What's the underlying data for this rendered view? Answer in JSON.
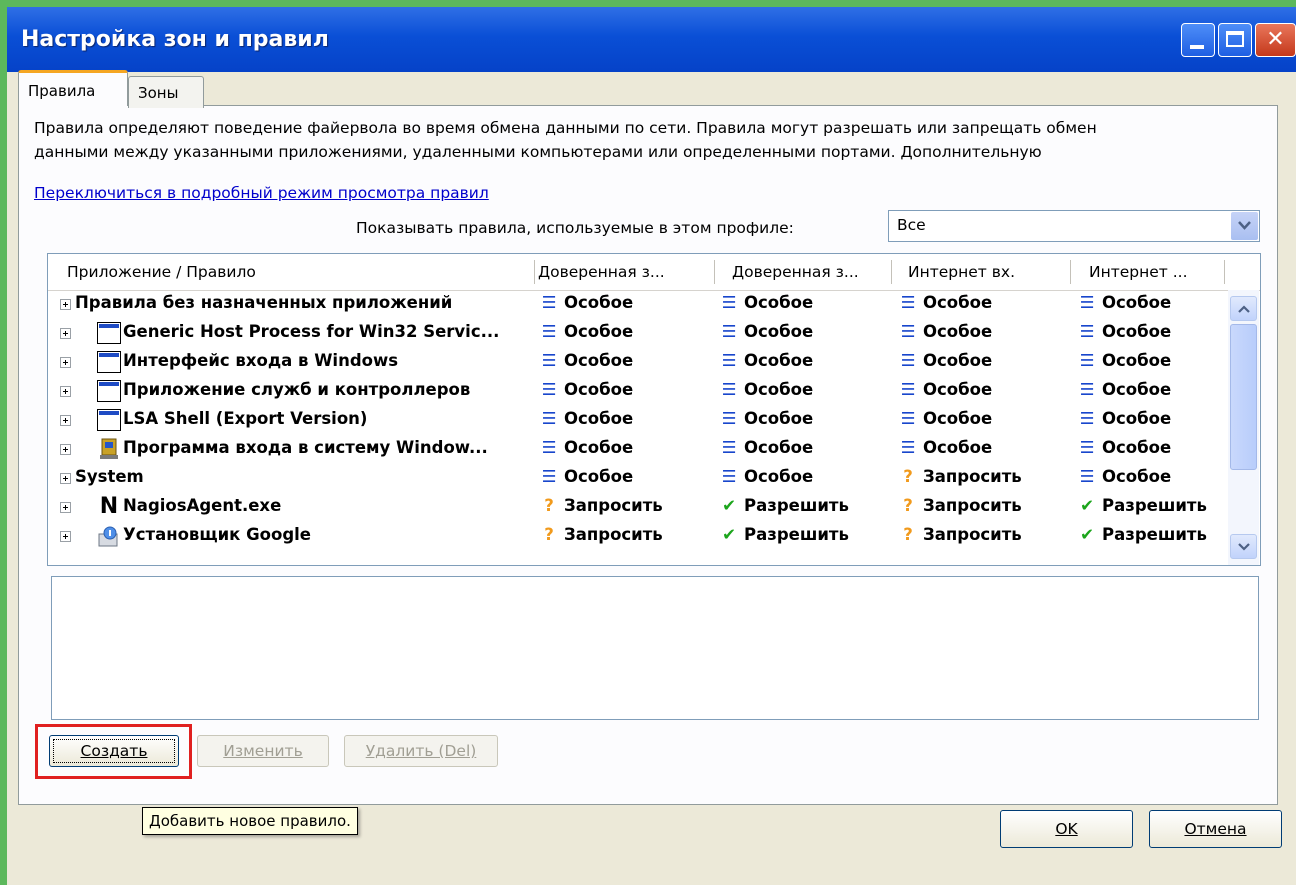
{
  "window": {
    "title": "Настройка зон и правил"
  },
  "tabs": [
    {
      "label": "Правила",
      "active": true
    },
    {
      "label": "Зоны",
      "active": false
    }
  ],
  "description": {
    "line1": "Правила определяют поведение файервола во время обмена данными по сети. Правила могут разрешать или запрещать обмен",
    "line2": "данными между указанными приложениями, удаленными компьютерами или определенными портами. Дополнительную"
  },
  "detail_link": "Переключиться в подробный режим просмотра правил",
  "profile": {
    "label": "Показывать правила, используемые в этом профиле:",
    "value": "Все"
  },
  "table": {
    "columns": [
      "Приложение / Правило",
      "Доверенная з...",
      "Доверенная з...",
      "Интернет вх.",
      "Интернет ..."
    ],
    "rows": [
      {
        "name": "Правила без назначенных приложений",
        "icon": "none",
        "cells": [
          {
            "icon": "lines-icon",
            "text": "Особое"
          },
          {
            "icon": "lines-icon",
            "text": "Особое"
          },
          {
            "icon": "lines-icon",
            "text": "Особое"
          },
          {
            "icon": "lines-icon",
            "text": "Особое"
          }
        ]
      },
      {
        "name": "Generic Host Process for Win32 Servic...",
        "icon": "window-icon",
        "cells": [
          {
            "icon": "lines-icon",
            "text": "Особое"
          },
          {
            "icon": "lines-icon",
            "text": "Особое"
          },
          {
            "icon": "lines-icon",
            "text": "Особое"
          },
          {
            "icon": "lines-icon",
            "text": "Особое"
          }
        ]
      },
      {
        "name": "Интерфейс входа в Windows",
        "icon": "window-icon",
        "cells": [
          {
            "icon": "lines-icon",
            "text": "Особое"
          },
          {
            "icon": "lines-icon",
            "text": "Особое"
          },
          {
            "icon": "lines-icon",
            "text": "Особое"
          },
          {
            "icon": "lines-icon",
            "text": "Особое"
          }
        ]
      },
      {
        "name": "Приложение служб и контроллеров",
        "icon": "window-icon",
        "cells": [
          {
            "icon": "lines-icon",
            "text": "Особое"
          },
          {
            "icon": "lines-icon",
            "text": "Особое"
          },
          {
            "icon": "lines-icon",
            "text": "Особое"
          },
          {
            "icon": "lines-icon",
            "text": "Особое"
          }
        ]
      },
      {
        "name": "LSA Shell (Export Version)",
        "icon": "window-icon",
        "cells": [
          {
            "icon": "lines-icon",
            "text": "Особое"
          },
          {
            "icon": "lines-icon",
            "text": "Особое"
          },
          {
            "icon": "lines-icon",
            "text": "Особое"
          },
          {
            "icon": "lines-icon",
            "text": "Особое"
          }
        ]
      },
      {
        "name": "Программа входа в систему Window...",
        "icon": "winlogon-icon",
        "cells": [
          {
            "icon": "lines-icon",
            "text": "Особое"
          },
          {
            "icon": "lines-icon",
            "text": "Особое"
          },
          {
            "icon": "lines-icon",
            "text": "Особое"
          },
          {
            "icon": "lines-icon",
            "text": "Особое"
          }
        ]
      },
      {
        "name": "System",
        "icon": "none",
        "cells": [
          {
            "icon": "lines-icon",
            "text": "Особое"
          },
          {
            "icon": "lines-icon",
            "text": "Особое"
          },
          {
            "icon": "question-icon",
            "text": "Запросить"
          },
          {
            "icon": "lines-icon",
            "text": "Особое"
          }
        ]
      },
      {
        "name": "NagiosAgent.exe",
        "icon": "nagios-icon",
        "cells": [
          {
            "icon": "question-icon",
            "text": "Запросить"
          },
          {
            "icon": "checkmark-icon",
            "text": "Разрешить"
          },
          {
            "icon": "question-icon",
            "text": "Запросить"
          },
          {
            "icon": "checkmark-icon",
            "text": "Разрешить"
          }
        ]
      },
      {
        "name": "Установщик Google",
        "icon": "installer-icon",
        "cells": [
          {
            "icon": "question-icon",
            "text": "Запросить"
          },
          {
            "icon": "checkmark-icon",
            "text": "Разрешить"
          },
          {
            "icon": "question-icon",
            "text": "Запросить"
          },
          {
            "icon": "checkmark-icon",
            "text": "Разрешить"
          }
        ]
      }
    ]
  },
  "buttons": {
    "create": "Создать",
    "edit": "Изменить",
    "delete": "Удалить (Del)",
    "ok": "OK",
    "cancel": "Отмена"
  },
  "tooltip": "Добавить новое правило.",
  "colors": {
    "titlebar": "#0a4fd6",
    "highlight_box": "#e02020",
    "lines_icon": "#1846cc",
    "question_icon": "#f19a1c",
    "checkmark_icon": "#1ca51c"
  }
}
